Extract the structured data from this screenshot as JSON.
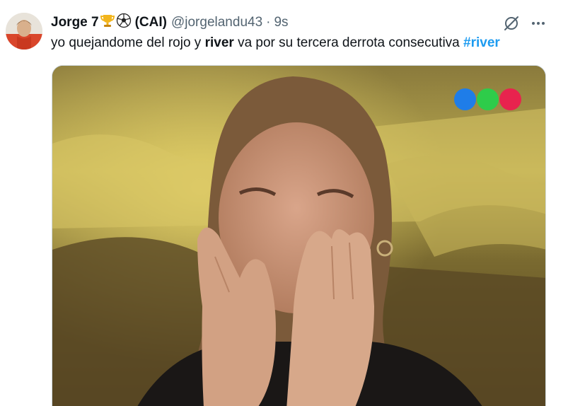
{
  "tweet": {
    "display_name": "Jorge 7",
    "name_suffix": "(CAI)",
    "emoji_names": [
      "trophy-emoji",
      "soccer-ball-emoji"
    ],
    "handle": "@jorgelandu43",
    "separator": "·",
    "time": "9s",
    "text_parts": {
      "before": "yo quejandome del rojo y ",
      "bold": "river",
      "after": " va por su tercera derrota consecutiva ",
      "hashtag": "#river"
    }
  },
  "icons": {
    "grok": "grok-icon",
    "more": "more-options-icon"
  },
  "media": {
    "type": "video-still",
    "description_subject": "woman-covering-face-with-hands",
    "logo_colors": [
      "#1f7de8",
      "#2ecc4a",
      "#e8234e"
    ]
  },
  "colors": {
    "text": "#0f1419",
    "secondary": "#536471",
    "accent": "#1d9bf0"
  }
}
